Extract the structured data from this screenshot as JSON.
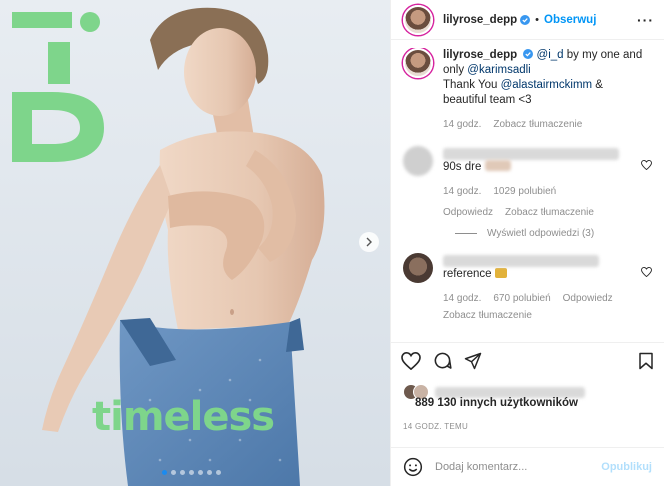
{
  "colors": {
    "accent": "#0095f6",
    "id_green": "#7ed58b",
    "muted": "#8e8e8e",
    "jeans": "#5b86b8",
    "skin": "#e6c7b1"
  },
  "post": {
    "overlay_text": "timeless",
    "carousel": {
      "count": 7,
      "active": 0
    }
  },
  "header": {
    "username": "lilyrose_depp",
    "separator": "•",
    "follow_label": "Obserwuj",
    "more": "···"
  },
  "caption": {
    "username": "lilyrose_depp",
    "mention1": "@i_d",
    "text1": " by my one and only ",
    "mention2": "@karimsadli",
    "text2": "Thank You ",
    "mention3": "@alastairmckimm",
    "text3": " & beautiful team <3",
    "time": "14 godz.",
    "translate": "Zobacz tłumaczenie"
  },
  "comments": [
    {
      "text_visible": "90s dre",
      "time": "14 godz.",
      "likes": "1029 polubień",
      "reply": "Odpowiedz",
      "translate": "Zobacz tłumaczenie",
      "replies_label": "Wyświetl odpowiedzi (3)"
    },
    {
      "text_visible": "reference",
      "time": "14 godz.",
      "likes": "670 polubień",
      "reply": "Odpowiedz",
      "translate": "Zobacz tłumaczenie"
    }
  ],
  "icons": {
    "like": "heart-icon",
    "comment": "comment-icon",
    "share": "send-icon",
    "save": "bookmark-icon"
  },
  "likes_text": "889 130 innych użytkowników",
  "timestamp": "14 GODZ. TEMU",
  "add_comment": {
    "placeholder": "Dodaj komentarz...",
    "publish_label": "Opublikuj"
  }
}
